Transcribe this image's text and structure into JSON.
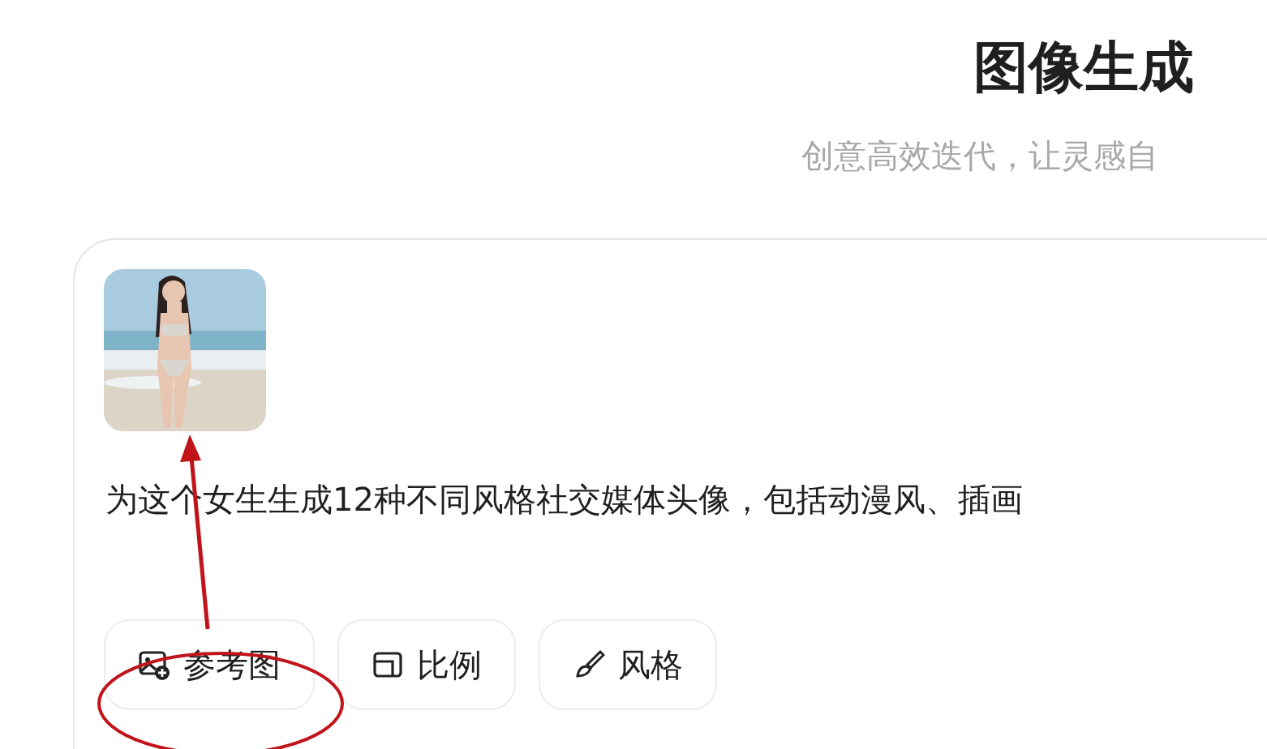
{
  "header": {
    "title": "图像生成",
    "subtitle": "创意高效迭代，让灵感自"
  },
  "composer": {
    "prompt": "为这个女生生成12种不同风格社交媒体头像，包括动漫风、插画",
    "options": [
      {
        "label": "参考图"
      },
      {
        "label": "比例"
      },
      {
        "label": "风格"
      }
    ]
  }
}
